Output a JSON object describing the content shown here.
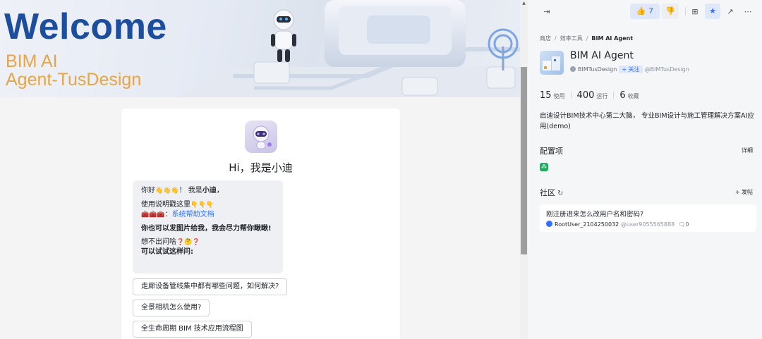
{
  "banner": {
    "headline": "Welcome",
    "sub_line1": "BIM AI",
    "sub_line2": "Agent-TusDesign"
  },
  "chat": {
    "greeting_title": "Hi，我是小迪",
    "bubble": {
      "line1_prefix": "你好",
      "line1_mid": "！ 我是",
      "line1_bold": "小迪",
      "line1_suffix": "，",
      "line2": "使用说明戳这里",
      "line3_prefix": "：",
      "line3_link": "系统帮助文档",
      "line4": "你也可以发图片给我，我会尽力帮你瞅瞅!",
      "line5": "想不出问啥",
      "line6": "可以试试这样问:"
    },
    "suggestions": [
      "走廊设备管线集中都有哪些问题，如何解决?",
      "全景相机怎么使用?",
      "全生命周期 BIM 技术应用流程图"
    ]
  },
  "topbar": {
    "like_count": "7"
  },
  "breadcrumb": {
    "items": [
      "商店",
      "效率工具",
      "BIM AI Agent"
    ]
  },
  "agent": {
    "name": "BIM AI Agent",
    "author": "BIMTusDesign",
    "follow_label": "+ 关注",
    "handle": "@BIMTusDesign",
    "stats": [
      {
        "value": "15",
        "label": "使用"
      },
      {
        "value": "400",
        "label": "运行"
      },
      {
        "value": "6",
        "label": "收藏"
      }
    ],
    "description": "启迪设计BIM技术中心第二大脑， 专业BIM设计与施工管理解决方案AI应用(demo)"
  },
  "config": {
    "title": "配置项",
    "detail_label": "详细"
  },
  "community": {
    "title": "社区",
    "post_label": "+ 发帖",
    "posts": [
      {
        "title": "刚注册进来怎么改用户名和密码?",
        "user": "RootUser_2104250032",
        "handle": "@user9055565888",
        "comments": "0"
      }
    ]
  },
  "colors": {
    "brand": "#3370ff",
    "headline": "#1d4e9e",
    "banner_sub": "#e6a547"
  }
}
